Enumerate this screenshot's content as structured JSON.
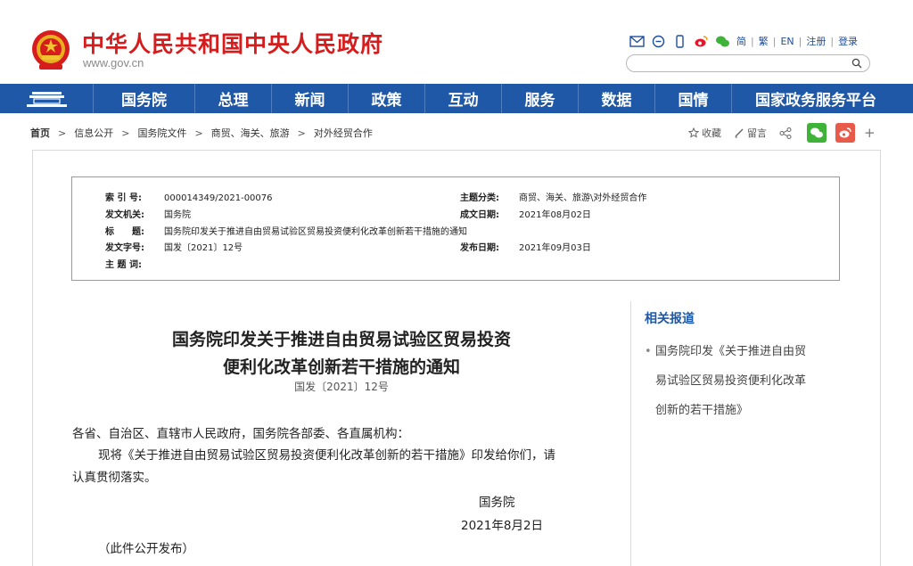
{
  "header": {
    "site_name": "中华人民共和国中央人民政府",
    "site_url": "www.gov.cn",
    "lang_links": [
      "简",
      "繁",
      "EN",
      "注册",
      "登录"
    ],
    "search_placeholder": ""
  },
  "nav": {
    "items": [
      "国务院",
      "总理",
      "新闻",
      "政策",
      "互动",
      "服务",
      "数据",
      "国情",
      "国家政务服务平台"
    ]
  },
  "breadcrumb": [
    "首页",
    "信息公开",
    "国务院文件",
    "商贸、海关、旅游",
    "对外经贸合作"
  ],
  "share": {
    "favorite": "收藏",
    "comment": "留言",
    "plus": "+"
  },
  "meta": {
    "index_label": "索 引 号:",
    "index_value": "000014349/2021-00076",
    "category_label": "主题分类:",
    "category_value": "商贸、海关、旅游\\对外经贸合作",
    "issuer_label": "发文机关:",
    "issuer_value": "国务院",
    "date_written_label": "成文日期:",
    "date_written_value": "2021年08月02日",
    "title_label": "标　　题:",
    "title_value": "国务院印发关于推进自由贸易试验区贸易投资便利化改革创新若干措施的通知",
    "docno_label": "发文字号:",
    "docno_value": "国发〔2021〕12号",
    "publish_label": "发布日期:",
    "publish_value": "2021年09月03日",
    "keywords_label": "主 题 词:",
    "keywords_value": ""
  },
  "article": {
    "title_line1": "国务院印发关于推进自由贸易试验区贸易投资",
    "title_line2": "便利化改革创新若干措施的通知",
    "doc_number": "国发〔2021〕12号",
    "salutation": "各省、自治区、直辖市人民政府，国务院各部委、各直属机构：",
    "body_line1": "现将《关于推进自由贸易试验区贸易投资便利化改革创新的若干措施》印发给你们，请",
    "body_line2": "认真贯彻落实。",
    "signature": "国务院",
    "date": "2021年8月2日",
    "note": "（此件公开发布）"
  },
  "sidebar": {
    "title": "相关报道",
    "items": [
      {
        "line1": "国务院印发《关于推进自由贸",
        "line2": "易试验区贸易投资便利化改革",
        "line3": "创新的若干措施》"
      }
    ]
  },
  "colors": {
    "brand_red": "#d61c1c",
    "nav_blue": "#1e58a6",
    "link_blue": "#1e4d9c"
  }
}
